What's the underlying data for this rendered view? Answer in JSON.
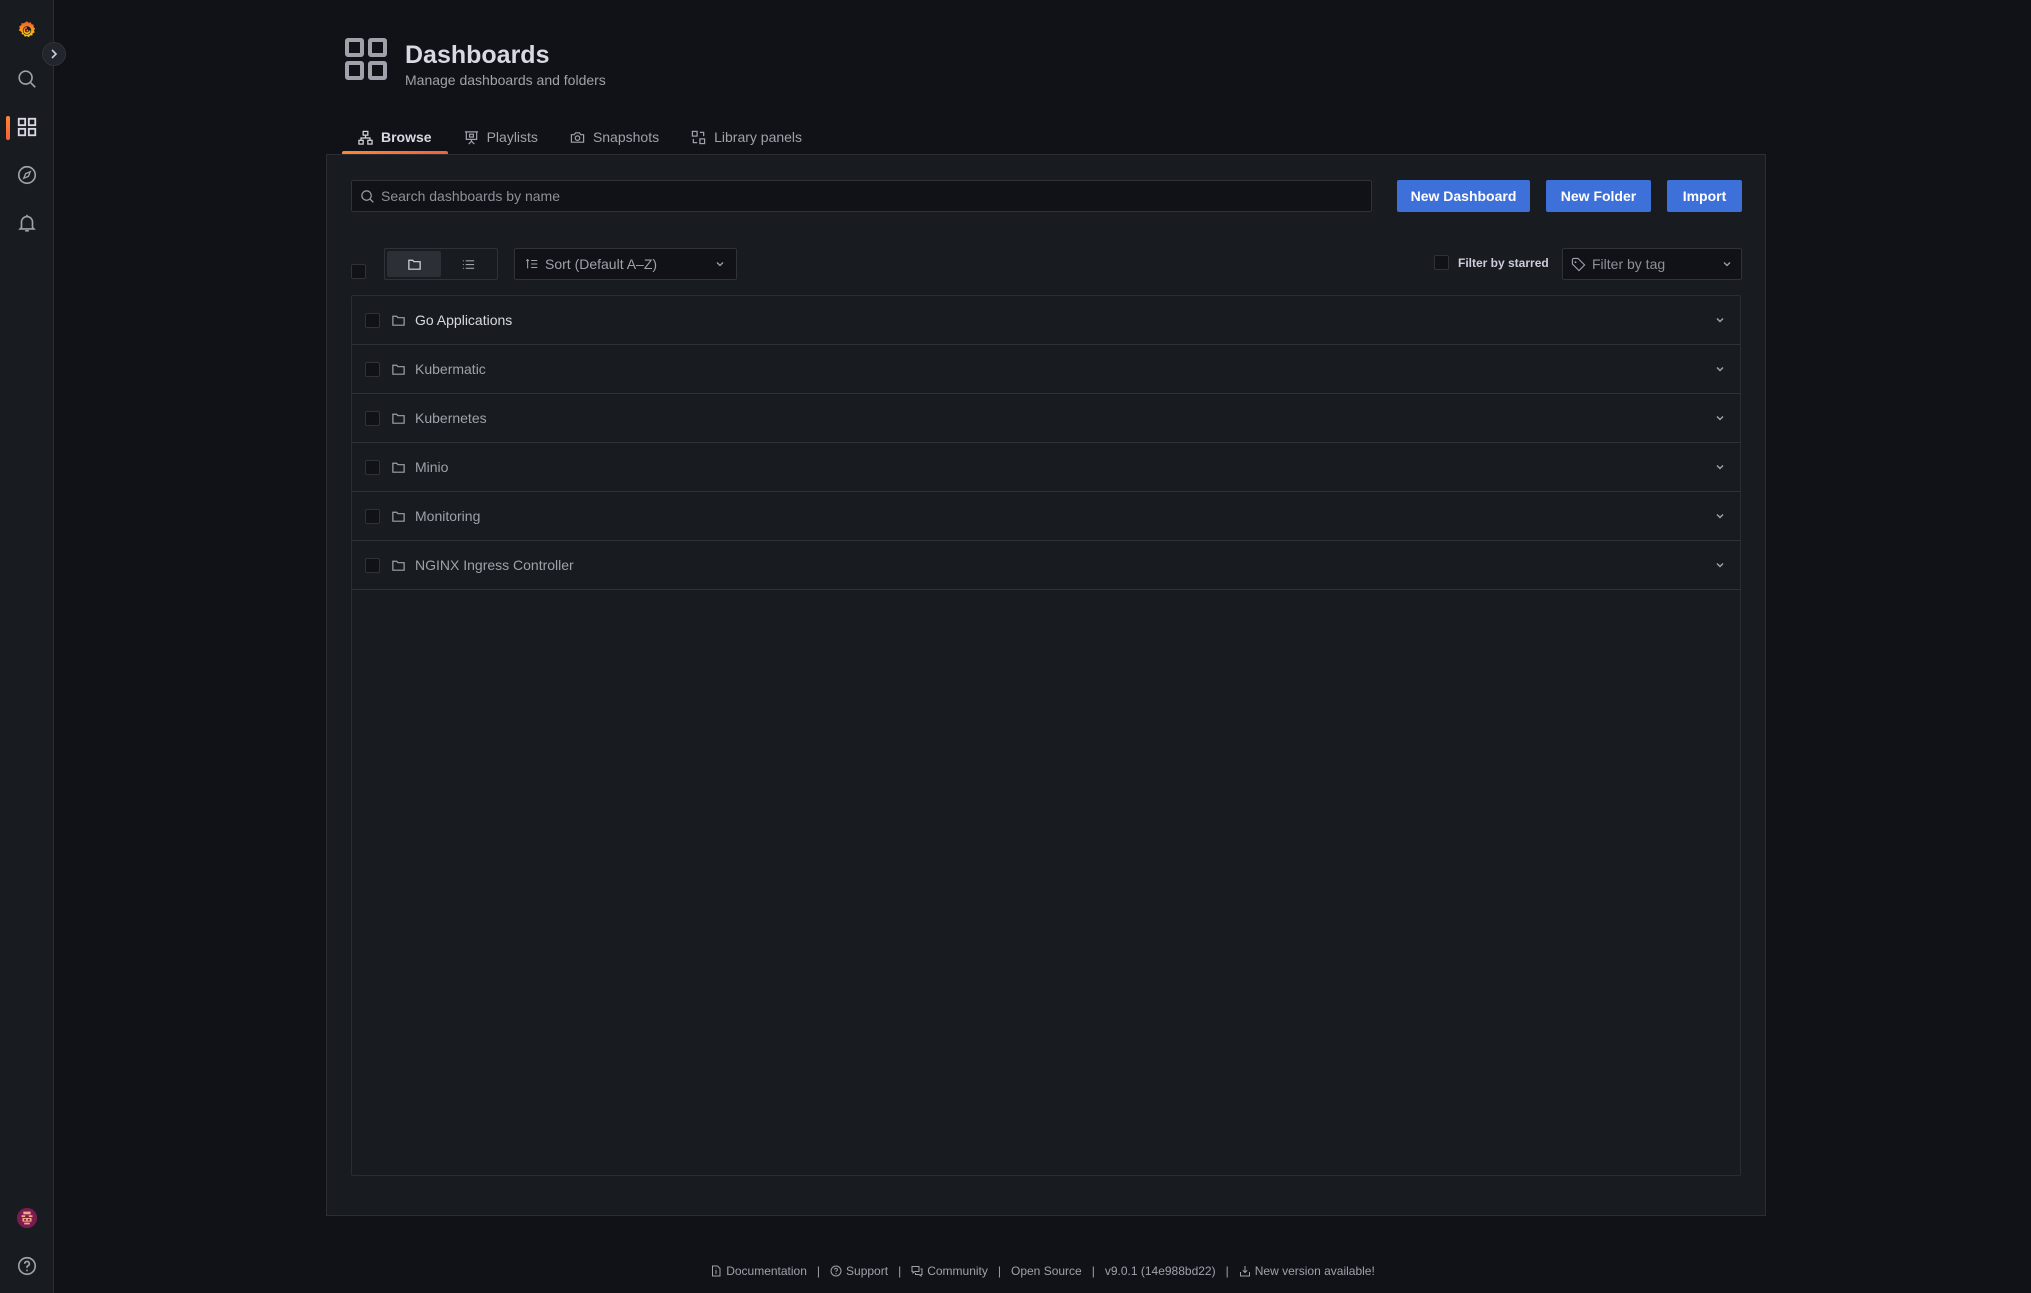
{
  "sidebar": {
    "logo": "grafana-logo-icon",
    "expand_icon": "chevron-right-icon",
    "items": [
      {
        "icon": "search-icon",
        "label": "Search"
      },
      {
        "icon": "dashboards-icon",
        "label": "Dashboards",
        "active": true
      },
      {
        "icon": "compass-icon",
        "label": "Explore"
      },
      {
        "icon": "bell-icon",
        "label": "Alerting"
      }
    ],
    "bottom": [
      {
        "icon": "avatar",
        "label": "Profile"
      },
      {
        "icon": "help-icon",
        "label": "Help"
      }
    ]
  },
  "header": {
    "title": "Dashboards",
    "subtitle": "Manage dashboards and folders"
  },
  "tabs": [
    {
      "label": "Browse",
      "icon": "sitemap-icon",
      "active": true
    },
    {
      "label": "Playlists",
      "icon": "presentation-icon",
      "active": false
    },
    {
      "label": "Snapshots",
      "icon": "camera-icon",
      "active": false
    },
    {
      "label": "Library panels",
      "icon": "library-panels-icon",
      "active": false
    }
  ],
  "toolbar": {
    "search_placeholder": "Search dashboards by name",
    "search_value": "",
    "new_dashboard": "New Dashboard",
    "new_folder": "New Folder",
    "import": "Import",
    "sort_label": "Sort (Default A–Z)",
    "filter_starred": "Filter by starred",
    "filter_tag_placeholder": "Filter by tag",
    "button_color": "#3d71d9"
  },
  "folders": [
    {
      "name": "Go Applications"
    },
    {
      "name": "Kubermatic"
    },
    {
      "name": "Kubernetes"
    },
    {
      "name": "Minio"
    },
    {
      "name": "Monitoring"
    },
    {
      "name": "NGINX Ingress Controller"
    }
  ],
  "footer": {
    "documentation": "Documentation",
    "support": "Support",
    "community": "Community",
    "open_source": "Open Source",
    "version": "v9.0.1 (14e988bd22)",
    "new_version": "New version available!"
  },
  "accent": "#f55f3e"
}
